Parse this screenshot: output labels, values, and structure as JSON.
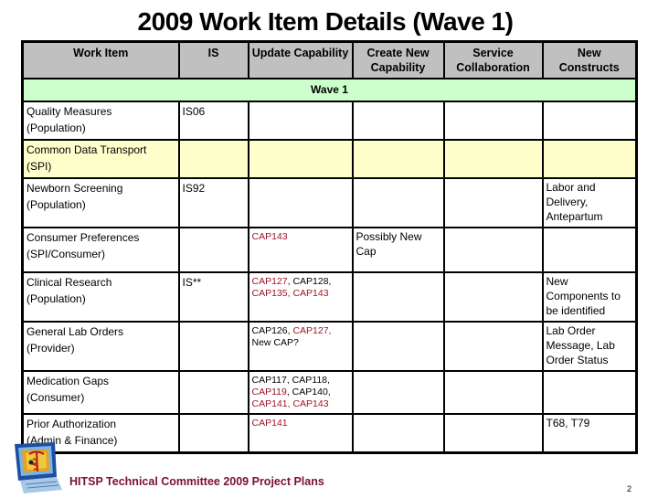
{
  "title": "2009 Work Item Details (Wave 1)",
  "table": {
    "headers": [
      "Work Item",
      "IS",
      "Update Capability",
      "Create New Capability",
      "Service Collaboration",
      "New Constructs"
    ],
    "wave_label": "Wave 1",
    "colors": {
      "header_bg": "#c0c0c0",
      "wave_bg": "#ccffcc",
      "highlight_row_bg": "#ffffcc",
      "new_cap_red": "#a01424"
    },
    "rows": [
      {
        "work_item": [
          "Quality Measures",
          "(Population)"
        ],
        "is": "IS06",
        "update_capability": [],
        "create_new_capability": "",
        "service_collaboration": "",
        "new_constructs": "",
        "highlight": false
      },
      {
        "work_item": [
          "Common Data Transport",
          "(SPI)"
        ],
        "is": "",
        "update_capability": [],
        "create_new_capability": "",
        "service_collaboration": "",
        "new_constructs": "",
        "highlight": true
      },
      {
        "work_item": [
          "Newborn Screening",
          "(Population)"
        ],
        "is": "IS92",
        "update_capability": [],
        "create_new_capability": "",
        "service_collaboration": "",
        "new_constructs": "Labor and Delivery, Antepartum",
        "highlight": false
      },
      {
        "work_item": [
          "Consumer Preferences",
          "(SPI/Consumer)"
        ],
        "is": "",
        "update_capability": [
          {
            "text": "CAP143",
            "red": true
          }
        ],
        "create_new_capability": "Possibly New Cap",
        "service_collaboration": "",
        "new_constructs": "",
        "highlight": false
      },
      {
        "work_item": [
          "Clinical Research",
          "(Population)"
        ],
        "is": "IS**",
        "update_capability": [
          {
            "text": "CAP127",
            "red": true
          },
          {
            "text": ", ",
            "red": false
          },
          {
            "text": "CAP128,",
            "red": false
          },
          {
            "text": "CAP135, CAP143",
            "red": true
          }
        ],
        "create_new_capability": "",
        "service_collaboration": "",
        "new_constructs": "New Components to be identified",
        "highlight": false
      },
      {
        "work_item": [
          "General Lab Orders",
          "(Provider)"
        ],
        "is": "",
        "update_capability": [
          {
            "text": "CAP126, ",
            "red": false
          },
          {
            "text": "CAP127,",
            "red": true
          },
          {
            "text": "New CAP?",
            "red": false
          }
        ],
        "create_new_capability": "",
        "service_collaboration": "",
        "new_constructs": "Lab Order Message, Lab Order Status",
        "highlight": false
      },
      {
        "work_item": [
          "Medication Gaps",
          "(Consumer)"
        ],
        "is": "",
        "update_capability": [
          {
            "text": "CAP117, CAP118,",
            "red": false
          },
          {
            "text": "CAP119",
            "red": true
          },
          {
            "text": ", CAP140,",
            "red": false
          },
          {
            "text": "CAP141, CAP143",
            "red": true
          }
        ],
        "create_new_capability": "",
        "service_collaboration": "",
        "new_constructs": "",
        "highlight": false
      },
      {
        "work_item": [
          "Prior Authorization",
          "(Admin & Finance)"
        ],
        "is": "",
        "update_capability": [
          {
            "text": "CAP141",
            "red": true
          }
        ],
        "create_new_capability": "",
        "service_collaboration": "",
        "new_constructs": "T68, T79",
        "highlight": false
      }
    ]
  },
  "footer": {
    "text": "HITSP Technical Committee 2009 Project Plans",
    "logo_icon": "computer-caduceus-logo-icon",
    "page_number": "2"
  }
}
